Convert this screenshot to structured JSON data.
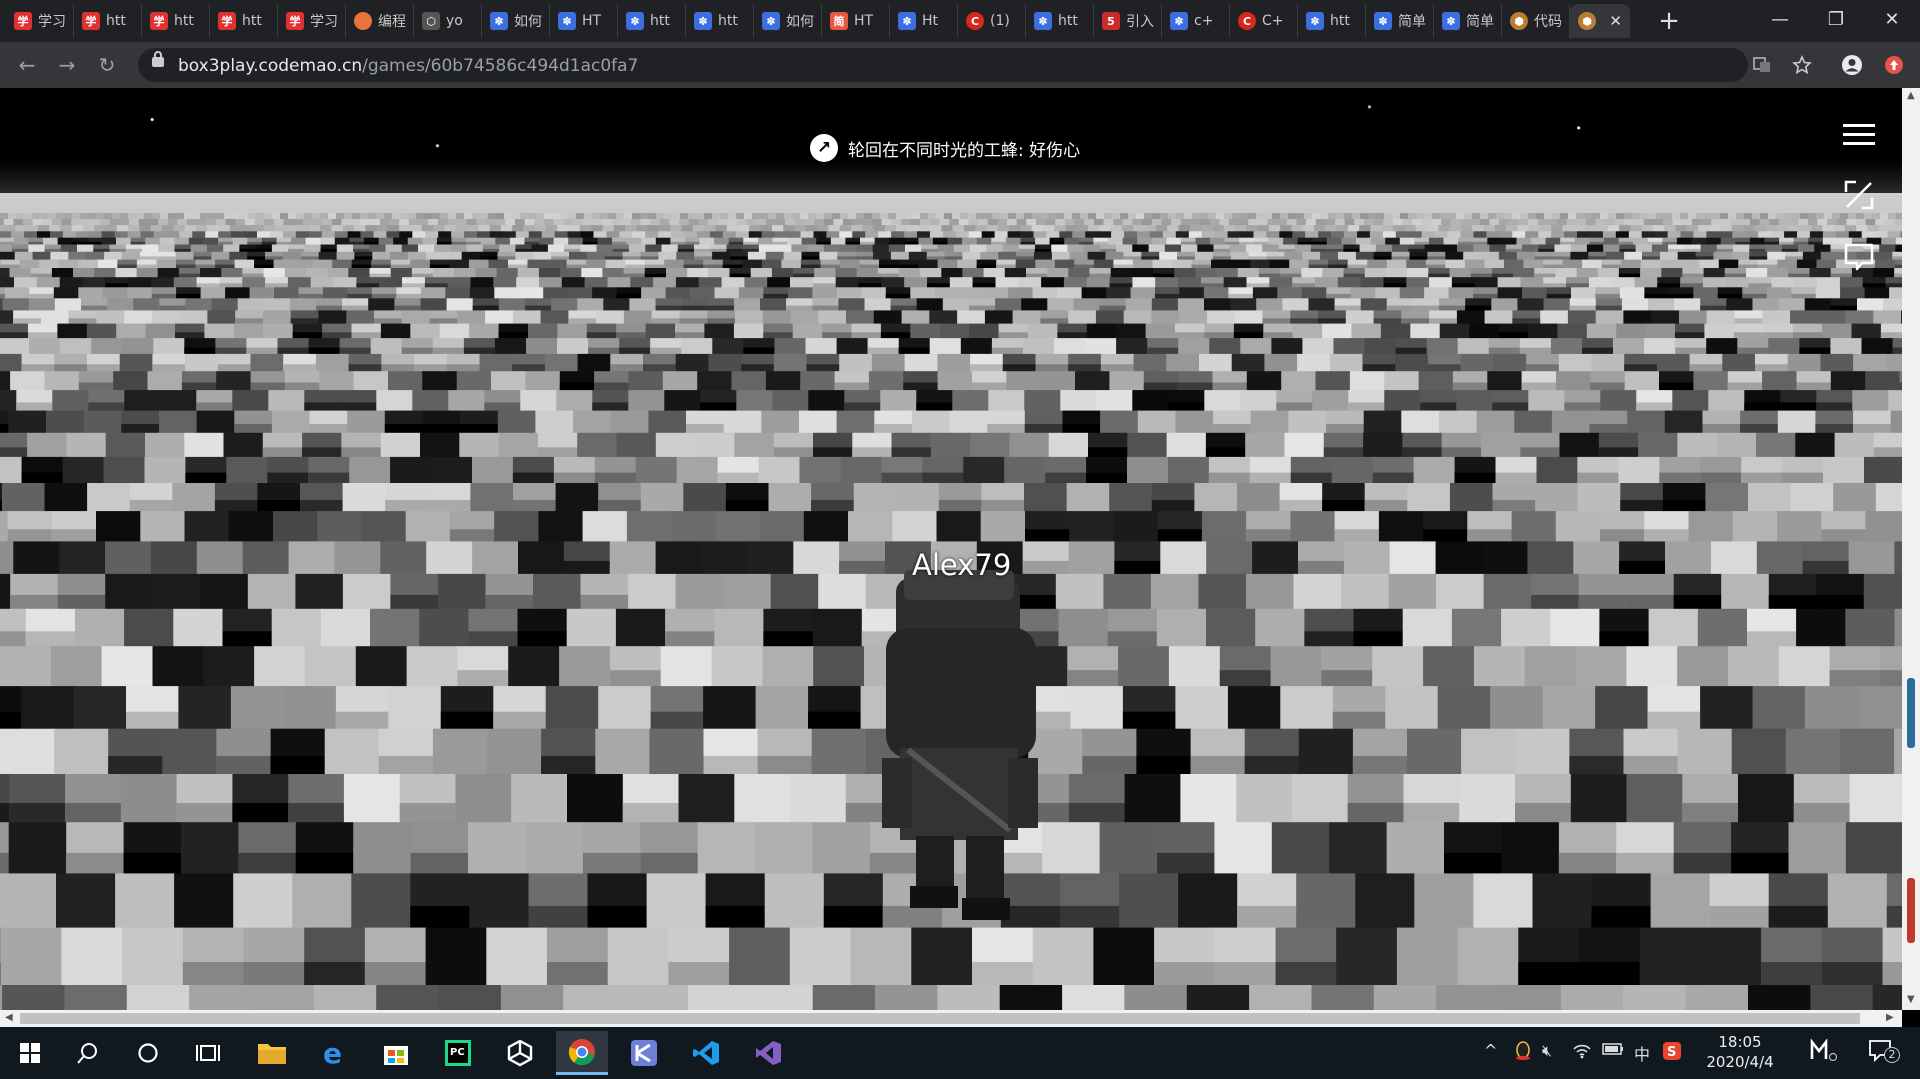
{
  "browser": {
    "tabs": [
      {
        "favicon": "xue-icon",
        "title": "学习"
      },
      {
        "favicon": "xue-icon",
        "title": "htt"
      },
      {
        "favicon": "xue-icon",
        "title": "htt"
      },
      {
        "favicon": "xue-icon",
        "title": "htt"
      },
      {
        "favicon": "xue-icon",
        "title": "学习"
      },
      {
        "favicon": "codemao-icon",
        "title": "编程"
      },
      {
        "favicon": "box-icon",
        "title": "yo"
      },
      {
        "favicon": "baidu-icon",
        "title": "如何"
      },
      {
        "favicon": "baidu-icon",
        "title": "HT"
      },
      {
        "favicon": "baidu-icon",
        "title": "htt"
      },
      {
        "favicon": "baidu-icon",
        "title": "htt"
      },
      {
        "favicon": "baidu-icon",
        "title": "如何"
      },
      {
        "favicon": "jianshu-icon",
        "title": "HT"
      },
      {
        "favicon": "baidu-icon",
        "title": "Ht"
      },
      {
        "favicon": "csdn-icon",
        "title": "(1)"
      },
      {
        "favicon": "baidu-icon",
        "title": "htt"
      },
      {
        "favicon": "five-icon",
        "title": "引入"
      },
      {
        "favicon": "baidu-icon",
        "title": "c+"
      },
      {
        "favicon": "csdn-icon",
        "title": "C+"
      },
      {
        "favicon": "baidu-icon",
        "title": "htt"
      },
      {
        "favicon": "baidu-icon",
        "title": "简单"
      },
      {
        "favicon": "baidu-icon",
        "title": "简单"
      },
      {
        "favicon": "gear-icon",
        "title": "代码"
      },
      {
        "favicon": "gear-icon",
        "title": ""
      }
    ],
    "close_glyph": "✕",
    "new_tab_glyph": "+",
    "window_controls": {
      "minimize": "—",
      "restore": "❐",
      "close": "✕"
    },
    "url_host": "box3play.codemao.cn",
    "url_path": "/games/60b74586c494d1ac0fa7",
    "nav": {
      "back": "←",
      "forward": "→",
      "reload": "↻"
    }
  },
  "game": {
    "notice_text": "轮回在不同时光的工蜂: 好伤心",
    "notice_icon_glyph": "↗",
    "player_name": "Alex79",
    "hud": {
      "menu": "menu-icon",
      "fullscreen": "fullscreen-icon",
      "chat": "chat-icon"
    }
  },
  "taskbar": {
    "time": "18:05",
    "date": "2020/4/4",
    "ime": "中",
    "notification_count": "2"
  }
}
